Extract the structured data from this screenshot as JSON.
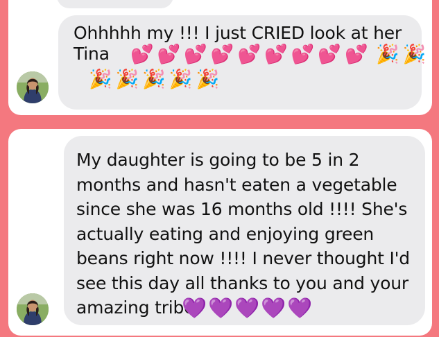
{
  "messages": [
    {
      "text": "Ohhhhh my !!! I just CRIED look at her\nTina",
      "hearts": "💕💕💕💕💕💕💕💕💕",
      "party_inline": "🎉🎉",
      "party_next_line": "🎉🎉🎉🎉🎉"
    },
    {
      "text": "My daughter is going to be 5 in 2 months and hasn't eaten a vegetable since she was 16 months old !!!! She's actually eating and enjoying green beans right now !!!! I never thought I'd see this day all thanks to you and your amazing tribe",
      "hearts": "💜💜💜💜💜"
    }
  ],
  "avatar_icon": "profile-photo",
  "colors": {
    "background": "#f4787f",
    "card": "#ffffff",
    "bubble": "#ebebed",
    "text": "#111111"
  }
}
